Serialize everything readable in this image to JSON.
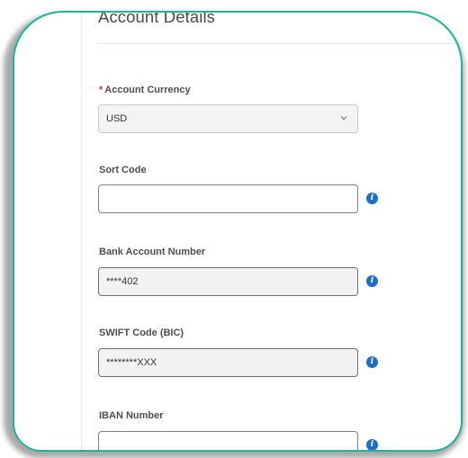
{
  "section": {
    "title": "Account Details"
  },
  "fields": {
    "currency": {
      "required_mark": "*",
      "label": "Account Currency",
      "value": "USD",
      "icon": "chevron-down-icon"
    },
    "sort_code": {
      "label": "Sort Code",
      "value": "",
      "icon": "info-icon"
    },
    "bank_account_number": {
      "label": "Bank Account Number",
      "value": "****402",
      "icon": "info-icon"
    },
    "swift_code": {
      "label": "SWIFT Code (BIC)",
      "value": "********XXX",
      "icon": "info-icon"
    },
    "iban_number": {
      "label": "IBAN Number",
      "value": "",
      "icon": "info-icon"
    }
  },
  "info_icon_glyph": "i",
  "colors": {
    "card_border": "#1db39a",
    "info_icon": "#1c6fc4",
    "required": "#d9302c"
  }
}
